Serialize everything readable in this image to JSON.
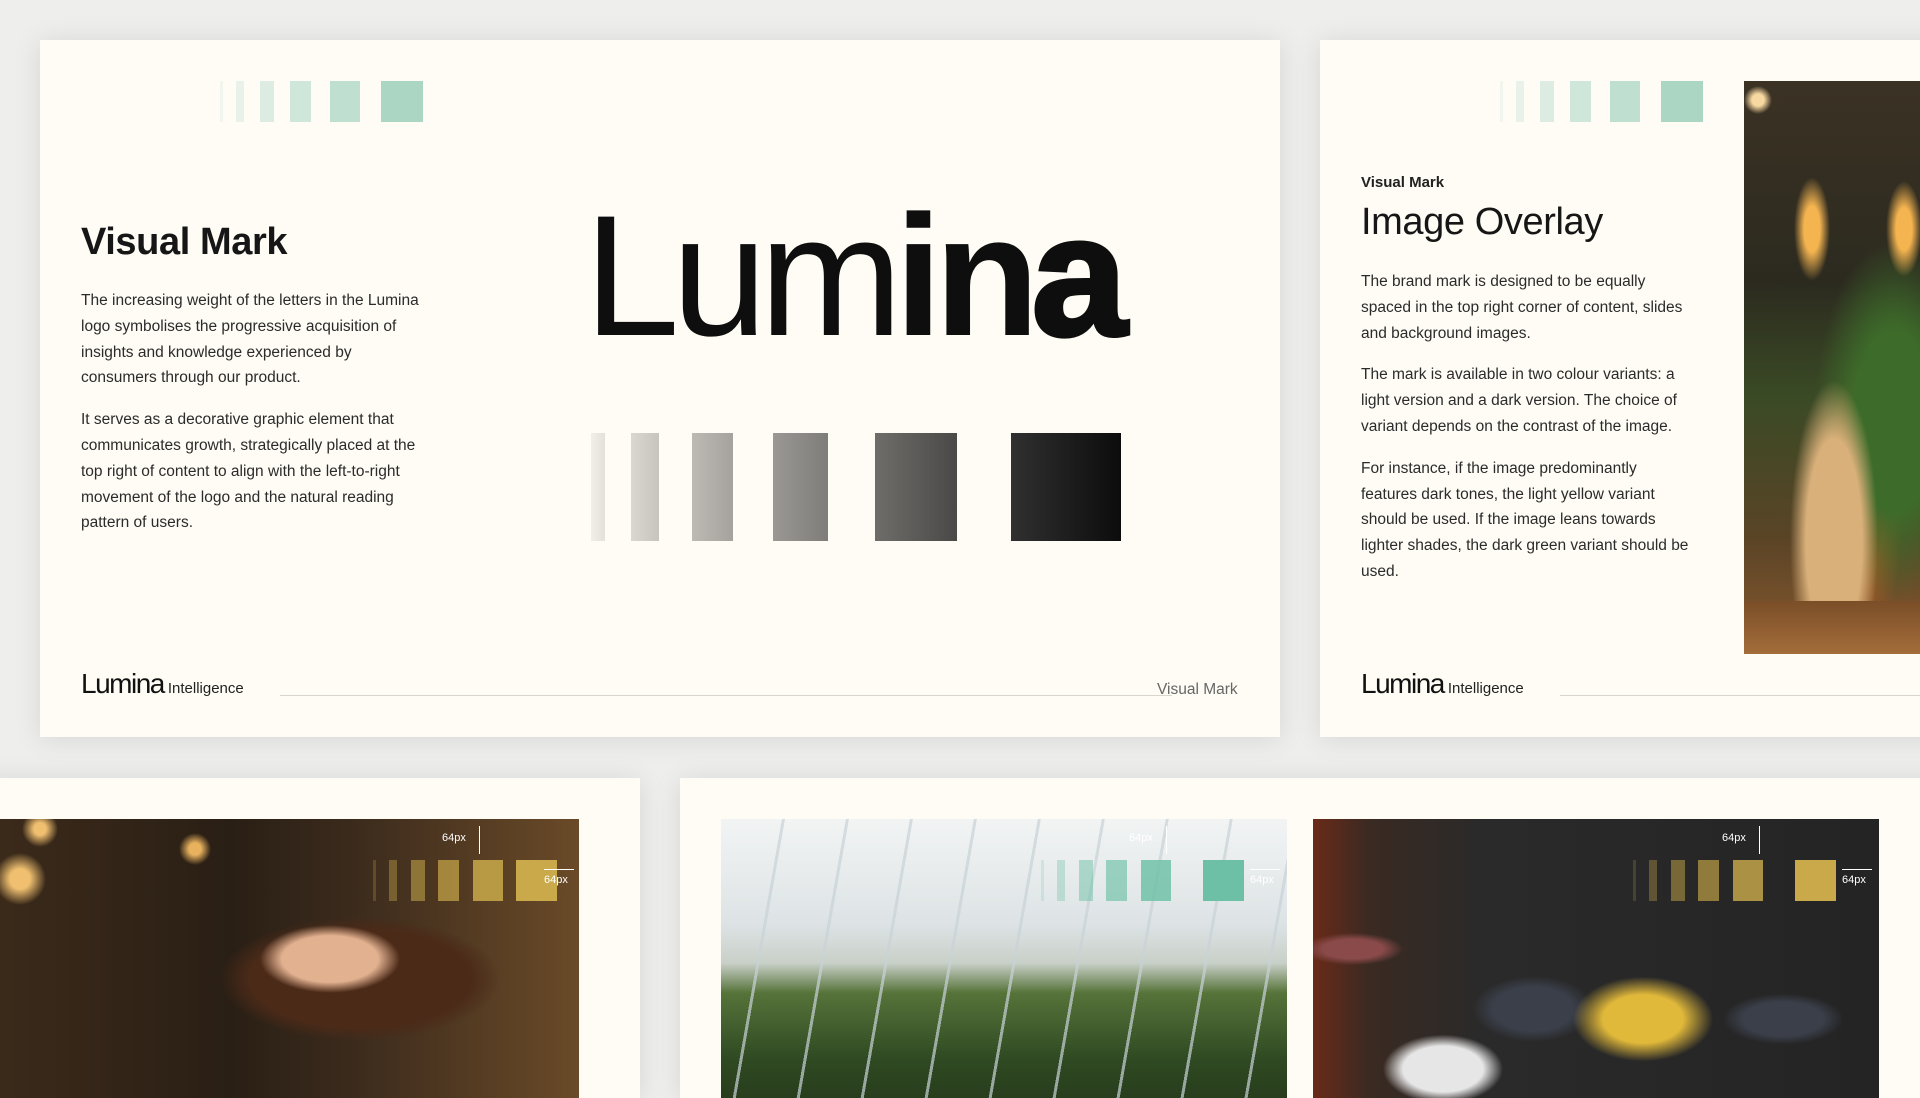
{
  "card_visual_mark": {
    "heading": "Visual Mark",
    "paragraph1": "The increasing weight of the letters in the Lumina logo symbolises the progressive acquisition of insights and knowledge experienced by consumers through our product.",
    "paragraph2": "It serves as a decorative graphic element that communicates growth, strategically placed at the top right of content to align with the left-to-right movement of the logo and the natural reading pattern of users.",
    "logo": {
      "part1": "L",
      "part2": "u",
      "part3": "m",
      "part4": "i",
      "part5": "n",
      "part6": "a"
    },
    "footer": {
      "brand": "Lumina",
      "brand_sub": "Intelligence",
      "section_label": "Visual Mark"
    }
  },
  "card_image_overlay": {
    "eyebrow": "Visual Mark",
    "heading": "Image Overlay",
    "paragraph1": "The brand mark is designed to be equally spaced in the top right corner of content, slides and background images.",
    "paragraph2": "The mark is available in two colour variants: a light version and a dark version. The choice of variant depends on the contrast of the image.",
    "paragraph3": "For instance, if the image predominantly features dark tones, the light yellow variant should be used. If the image leans towards lighter shades, the dark green variant should be used.",
    "footer": {
      "brand": "Lumina",
      "brand_sub": "Intelligence"
    }
  },
  "photo_examples": {
    "spacing_label": "64px"
  },
  "colors": {
    "background": "#fefcf4",
    "mint_mark": "#a7d4c3",
    "teal_mark": "#6dc0a6",
    "gold_mark": "#c9a94a",
    "dark_mark": "#0d0d0d"
  }
}
